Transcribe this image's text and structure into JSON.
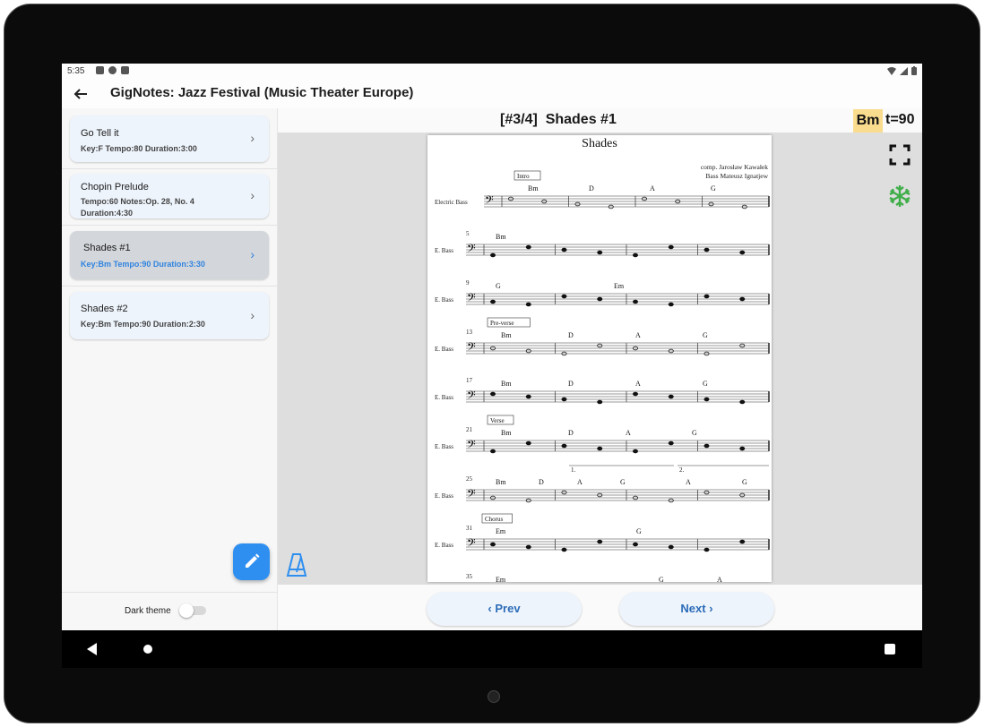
{
  "status": {
    "time": "5:35"
  },
  "app": {
    "title": "GigNotes: Jazz Festival (Music Theater Europe)"
  },
  "setlist": [
    {
      "title": "Go Tell it",
      "subtitle": "Key:F  Tempo:80  Duration:3:00"
    },
    {
      "title": "Chopin Prelude",
      "subtitle": "Tempo:60  Notes:Op. 28, No. 4 Duration:4:30"
    },
    {
      "title": "Shades #1",
      "subtitle": "Key:Bm  Tempo:90  Duration:3:30"
    },
    {
      "title": "Shades #2",
      "subtitle": "Key:Bm  Tempo:90  Duration:2:30"
    }
  ],
  "selected_index": 2,
  "song_header": {
    "position": "[#3/4]",
    "title": "Shades #1",
    "key": "Bm",
    "tempo": "t=90"
  },
  "settings": {
    "dark_theme_label": "Dark theme",
    "dark_theme_on": false
  },
  "nav": {
    "prev_label": "Prev",
    "next_label": "Next"
  },
  "sheet": {
    "title": "Shades",
    "composer": "comp. Jarosław Kawałek",
    "arranger": "Bass Mateusz Ignatjew",
    "instrument_first": "Electric Bass",
    "instrument_short": "E. Bass",
    "systems": [
      {
        "measure": "",
        "label": "Intro",
        "chords": [
          "Bm",
          "D",
          "A",
          "G"
        ]
      },
      {
        "measure": "5",
        "label": "",
        "chords": [
          "Bm"
        ]
      },
      {
        "measure": "9",
        "label": "",
        "chords": [
          "G",
          "Em"
        ]
      },
      {
        "measure": "13",
        "label": "Pre-verse",
        "chords": [
          "Bm",
          "D",
          "A",
          "G"
        ]
      },
      {
        "measure": "17",
        "label": "",
        "chords": [
          "Bm",
          "D",
          "A",
          "G"
        ]
      },
      {
        "measure": "21",
        "label": "Verse",
        "chords": [
          "Bm",
          "D",
          "A",
          "G"
        ]
      },
      {
        "measure": "25",
        "label": "",
        "chords": [
          "Bm",
          "D",
          "A",
          "G",
          "A",
          "G"
        ],
        "endings": [
          "1.",
          "2."
        ]
      },
      {
        "measure": "31",
        "label": "Chorus",
        "chords": [
          "Em",
          "G"
        ]
      },
      {
        "measure": "35",
        "label": "",
        "chords": [
          "Em",
          "G",
          "A"
        ]
      }
    ]
  },
  "colors": {
    "accent": "#2f8ff0",
    "key_highlight": "#f9dc8e",
    "freeze_icon": "#3fae49",
    "metronome_icon": "#2f8ff0"
  }
}
